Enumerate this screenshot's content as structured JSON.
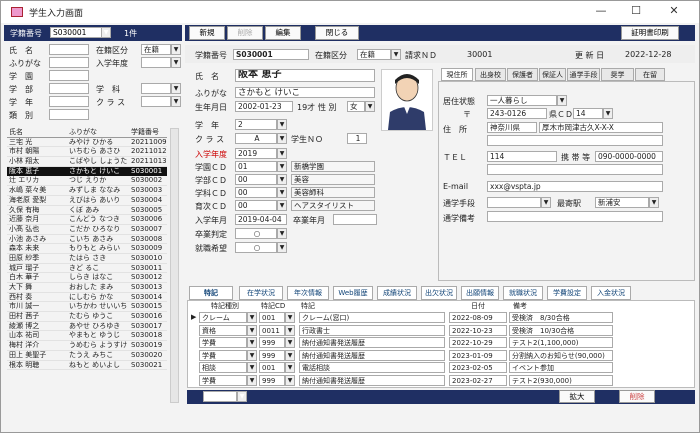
{
  "window": {
    "title": "学生入力画面",
    "min": "—",
    "max": "☐",
    "close": "✕"
  },
  "left": {
    "top_label": "学籍番号",
    "top_value": "S030001",
    "count": "1件",
    "filters": [
      {
        "l": "氏　名",
        "l2": "在籍区分",
        "v2": "在籍"
      },
      {
        "l": "ふりがな",
        "l2": "入学年度",
        "v2": ""
      },
      {
        "l": "学　園",
        "l2": "",
        "v2": ""
      },
      {
        "l": "学　部",
        "l2": "学　科",
        "v2": ""
      },
      {
        "l": "学　年",
        "l2": "ク ラ ス",
        "v2": ""
      },
      {
        "l": "類　別",
        "l2": "",
        "v2": ""
      }
    ],
    "list_headers": [
      "氏名",
      "ふりがな",
      "学籍番号"
    ],
    "rows": [
      [
        "三宅 光",
        "みやけ ひかる",
        "20211009"
      ],
      [
        "市村 朝陽",
        "いちむら あさひ",
        "20211012"
      ],
      [
        "小林 翔太",
        "こばやし しょうた",
        "20211013"
      ],
      [
        "阪本 恵子",
        "さかもと けいこ",
        "S030001"
      ],
      [
        "辻 エリカ",
        "つじ えりか",
        "S030002"
      ],
      [
        "水嶋 菜々美",
        "みずしま ななみ",
        "S030003"
      ],
      [
        "海老原 愛梨",
        "えびはら あいり",
        "S030004"
      ],
      [
        "久保 有梅",
        "くぼ あみ",
        "S030005"
      ],
      [
        "近藤 奈月",
        "こんどう なつき",
        "S030006"
      ],
      [
        "小髙 弘也",
        "こだか ひろなり",
        "S030007"
      ],
      [
        "小池 あさみ",
        "こいち あさみ",
        "S030008"
      ],
      [
        "森本 未来",
        "もりもと みらい",
        "S030009"
      ],
      [
        "田原 紗季",
        "たはら さき",
        "S030010"
      ],
      [
        "城戸 瑠子",
        "きど るこ",
        "S030011"
      ],
      [
        "白木 華子",
        "しらき はなこ",
        "S030012"
      ],
      [
        "大下 舞",
        "おおした まみ",
        "S030013"
      ],
      [
        "西村 奏",
        "にしむら かな",
        "S030014"
      ],
      [
        "市川 誠一",
        "いちかわ せいいち",
        "S030015"
      ],
      [
        "田村 茜子",
        "たむら ゆうこ",
        "S030016"
      ],
      [
        "綾瀬 博之",
        "あやせ ひろゆき",
        "S030017"
      ],
      [
        "山本 祐司",
        "やまもと ゆうじ",
        "S030018"
      ],
      [
        "梅村 洋介",
        "うめむら ようすけ",
        "S030019"
      ],
      [
        "田上 美聖子",
        "たうえ みちこ",
        "S030020"
      ],
      [
        "根本 明聴",
        "ねもと めいよし",
        "S030021"
      ]
    ]
  },
  "toolbar": {
    "new": "新規",
    "delete": "削除",
    "edit": "編集",
    "close": "閉じる",
    "cert": "証明書印刷"
  },
  "header": {
    "id_label": "学籍番号",
    "id": "S030001",
    "status_label": "在籍区分",
    "status": "在籍",
    "req_label": "請求ＮＤ",
    "req": "30001",
    "upd_label": "更 新 日",
    "upd": "2022-12-28"
  },
  "form": {
    "name_l": "氏　名",
    "name": "阪本 恵子",
    "kana_l": "ふりがな",
    "kana": "さかもと けいこ",
    "dob_l": "生年月日",
    "dob": "2002-01-23",
    "age": "19才",
    "sex_l": "性 別",
    "sex": "女",
    "grade_l": "学　年",
    "grade": "2",
    "class_l": "ク ラ ス",
    "class": "A",
    "sno_l": "学生ＮＯ",
    "sno": "1",
    "year_l": "入学年度",
    "year": "2019",
    "campus_l": "学園ＣＤ",
    "campus_cd": "01",
    "campus": "新橋学園",
    "dept_l": "学部ＣＤ",
    "dept_cd": "00",
    "dept": "美容",
    "major_l": "学科ＣＤ",
    "major_cd": "00",
    "major": "美容師科",
    "course_l": "育次ＣＤ",
    "course_cd": "00",
    "course": "ヘアスタイリスト",
    "ent_l": "入学年月",
    "ent": "2019-04-04",
    "grad_l": "卒業年月",
    "grad": "",
    "gj_l": "卒業判定",
    "gj": "○",
    "emp_l": "就職希望",
    "emp": "○"
  },
  "tabs": [
    "現住所",
    "出身校",
    "保護者",
    "保証人",
    "通学手段",
    "奨学",
    "在留"
  ],
  "addr": {
    "live_l": "居住状態",
    "live": "一人暮らし",
    "zip_l": "〒",
    "zip": "243-0126",
    "pref_l": "県ＣＤ",
    "pref": "14",
    "addr_l": "住　所",
    "addr1": "神奈川県",
    "addr2": "厚木市岡津古久X-X-X",
    "tel_l": "ＴＥＬ",
    "tel": "114",
    "mob_l": "携 帯 等",
    "mob": "090-0000-0000",
    "mail_l": "E-mail",
    "mail": "xxx@vspta.jp",
    "com_l": "通学手段",
    "sta_l": "最寄駅",
    "sta": "新浦安",
    "note_l": "通学備考"
  },
  "btabs": [
    "特記",
    "在学状況",
    "年次情報",
    "Web履歴",
    "成績状況",
    "出欠状況",
    "出願情報",
    "就職状況",
    "学費設定",
    "入金状況"
  ],
  "grid": {
    "headers": [
      "特記種別",
      "特記CD",
      "特記",
      "日付",
      "備考"
    ],
    "rows": [
      [
        "クレーム",
        "001",
        "クレーム(窓口)",
        "2022-08-09",
        "受検済　8/30合格"
      ],
      [
        "資格",
        "0011",
        "行政書士",
        "2022-10-23",
        "受検済　10/30合格"
      ],
      [
        "学費",
        "999",
        "納付通知書発送履歴",
        "2022-10-29",
        "テスト2(1,100,000)"
      ],
      [
        "学費",
        "999",
        "納付通知書発送履歴",
        "2023-01-09",
        "分割納入のお知らせ(90,000)"
      ],
      [
        "相談",
        "001",
        "電話相談",
        "2023-02-05",
        "イベント参加"
      ],
      [
        "学費",
        "999",
        "納付通知書発送履歴",
        "2023-02-27",
        "テスト2(930,000)"
      ]
    ],
    "expand": "拡大",
    "del": "削除"
  }
}
